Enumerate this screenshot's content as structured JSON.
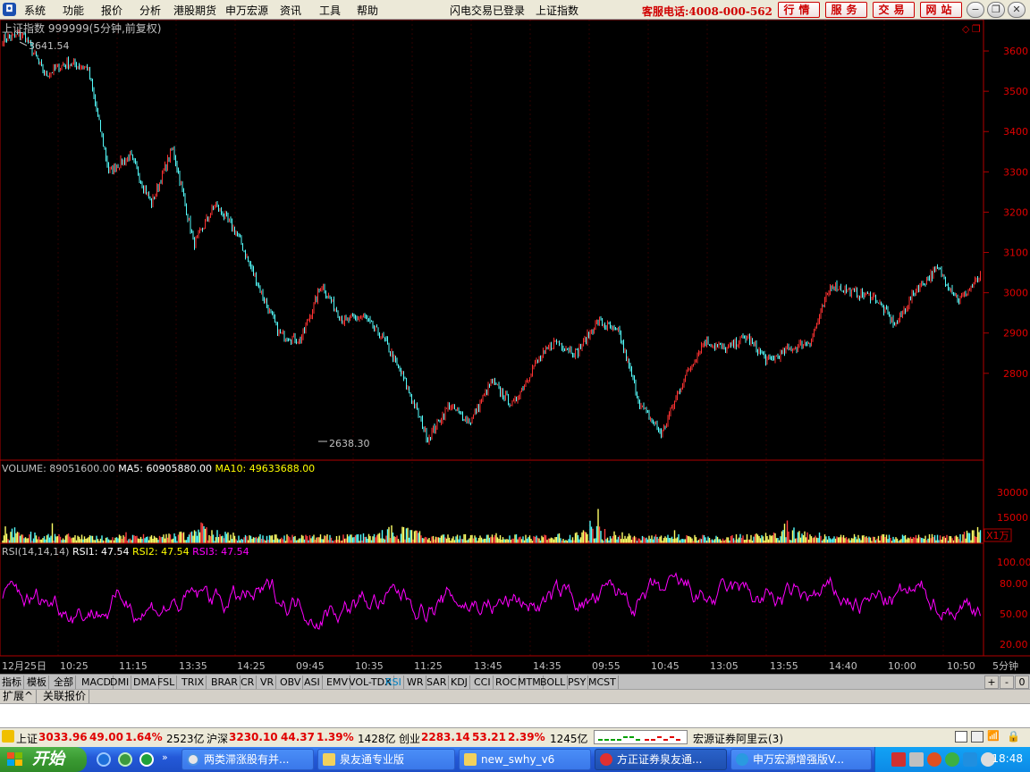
{
  "menu": {
    "items": [
      "系统",
      "功能",
      "报价",
      "分析",
      "港股期货",
      "申万宏源",
      "资讯",
      "工具",
      "帮助"
    ],
    "center_status": "闪电交易已登录",
    "center_index": "上证指数",
    "hotline": "客服电话:4008-000-562",
    "right_buttons": [
      "行情",
      "服务",
      "交易",
      "网站"
    ]
  },
  "main_chart": {
    "title": "上证指数 999999(5分钟,前复权)",
    "high_label": "3641.54",
    "low_label": "2638.30",
    "y_ticks": [
      "3600",
      "3500",
      "3400",
      "3300",
      "3200",
      "3100",
      "3000",
      "2900",
      "2800"
    ]
  },
  "volume": {
    "title_prefix": "VOLUME:",
    "value": "89051600.00",
    "ma5_label": "MA5:",
    "ma5_value": "60905880.00",
    "ma10_label": "MA10:",
    "ma10_value": "49633688.00",
    "y_ticks": [
      "30000",
      "15000"
    ],
    "unit": "X1万"
  },
  "rsi": {
    "title": "RSI(14,14,14)",
    "rsi1": "RSI1: 47.54",
    "rsi2": "RSI2: 47.54",
    "rsi3": "RSI3: 47.54",
    "y_ticks": [
      "100.00",
      "80.00",
      "50.00",
      "20.00"
    ]
  },
  "x_axis": {
    "labels": [
      "12月25日",
      "10:25",
      "11:15",
      "13:35",
      "14:25",
      "09:45",
      "10:35",
      "11:25",
      "13:45",
      "14:35",
      "09:55",
      "10:45",
      "13:05",
      "13:55",
      "14:40",
      "10:00",
      "10:50"
    ],
    "period": "5分钟"
  },
  "indicator_tabs": [
    "指标",
    "模板",
    "全部",
    "MACD",
    "DMI",
    "DMA",
    "FSL",
    "TRIX",
    "BRAR",
    "CR",
    "VR",
    "OBV",
    "ASI",
    "EMV",
    "VOL-TDX",
    "RSI",
    "WR",
    "SAR",
    "KDJ",
    "CCI",
    "ROC",
    "MTM",
    "BOLL",
    "PSY",
    "MCST"
  ],
  "tab_nav": [
    "+",
    "-",
    "0"
  ],
  "bottom_tabs": [
    "扩展^",
    "关联报价"
  ],
  "status": {
    "sh_label": "上证",
    "sh_value": "3033.96",
    "sh_change": "49.00",
    "sh_pct": "1.64%",
    "sh_amount": "2523亿",
    "hs_label": "沪深",
    "hs_value": "3230.10",
    "hs_change": "44.37",
    "hs_pct": "1.39%",
    "hs_amount": "1428亿",
    "cy_label": "创业",
    "cy_value": "2283.14",
    "cy_change": "53.21",
    "cy_pct": "2.39%",
    "cy_amount": "1245亿",
    "server": "宏源证券阿里云(3)"
  },
  "taskbar": {
    "start": "开始",
    "windows": [
      "两类滞涨股有并...",
      "泉友通专业版",
      "new_swhy_v6",
      "方正证券泉友通...",
      "申万宏源增强版V..."
    ],
    "clock": "18:48"
  },
  "colors": {
    "up": "#ff3232",
    "down": "#54fcfc",
    "rsi": "#ff00ff",
    "ma5": "#ffffff",
    "ma10": "#ffff00"
  },
  "chart_data": {
    "type": "candlestick",
    "series": [
      {
        "name": "上证指数 999999",
        "points": [
          {
            "x": "12月25日",
            "y": 3630
          },
          {
            "x": "",
            "y": 3641.54
          },
          {
            "x": "",
            "y": 3540
          },
          {
            "x": "",
            "y": 3570
          },
          {
            "x": "10:25",
            "y": 3560
          },
          {
            "x": "",
            "y": 3300
          },
          {
            "x": "",
            "y": 3340
          },
          {
            "x": "",
            "y": 3220
          },
          {
            "x": "",
            "y": 3360
          },
          {
            "x": "11:15",
            "y": 3120
          },
          {
            "x": "",
            "y": 3220
          },
          {
            "x": "",
            "y": 3150
          },
          {
            "x": "13:35",
            "y": 3020
          },
          {
            "x": "",
            "y": 2900
          },
          {
            "x": "",
            "y": 2880
          },
          {
            "x": "14:25",
            "y": 3020
          },
          {
            "x": "",
            "y": 2930
          },
          {
            "x": "",
            "y": 2940
          },
          {
            "x": "",
            "y": 2880
          },
          {
            "x": "09:45",
            "y": 2770
          },
          {
            "x": "",
            "y": 2638.3
          },
          {
            "x": "",
            "y": 2720
          },
          {
            "x": "10:35",
            "y": 2680
          },
          {
            "x": "",
            "y": 2780
          },
          {
            "x": "11:25",
            "y": 2720
          },
          {
            "x": "",
            "y": 2820
          },
          {
            "x": "",
            "y": 2880
          },
          {
            "x": "13:45",
            "y": 2850
          },
          {
            "x": "",
            "y": 2930
          },
          {
            "x": "14:35",
            "y": 2900
          },
          {
            "x": "",
            "y": 2720
          },
          {
            "x": "09:55",
            "y": 2650
          },
          {
            "x": "",
            "y": 2780
          },
          {
            "x": "",
            "y": 2880
          },
          {
            "x": "10:45",
            "y": 2860
          },
          {
            "x": "",
            "y": 2890
          },
          {
            "x": "13:05",
            "y": 2830
          },
          {
            "x": "",
            "y": 2860
          },
          {
            "x": "",
            "y": 2880
          },
          {
            "x": "13:55",
            "y": 3020
          },
          {
            "x": "",
            "y": 3000
          },
          {
            "x": "14:40",
            "y": 2990
          },
          {
            "x": "",
            "y": 2920
          },
          {
            "x": "10:00",
            "y": 3010
          },
          {
            "x": "",
            "y": 3060
          },
          {
            "x": "10:50",
            "y": 2980
          },
          {
            "x": "",
            "y": 3040
          }
        ]
      }
    ],
    "ylim": [
      2600,
      3660
    ]
  }
}
